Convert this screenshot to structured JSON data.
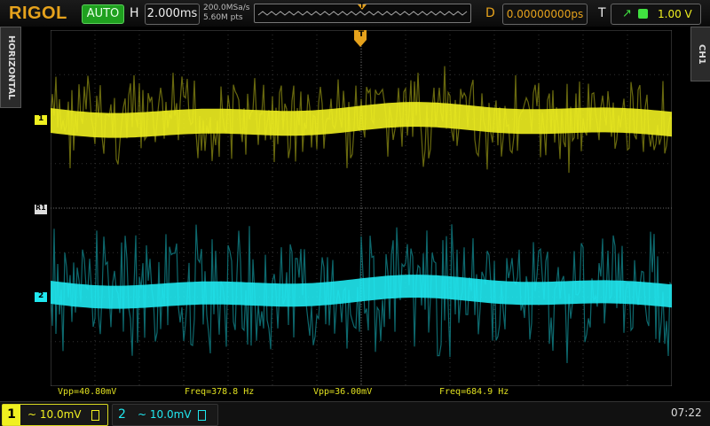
{
  "header": {
    "brand": "RIGOL",
    "run_mode": "AUTO",
    "timebase_letter": "H",
    "timebase": "2.000ms",
    "sample_rate": "200.0MSa/s",
    "memory_depth": "5.60M pts",
    "delay_letter": "D",
    "delay": "0.00000000ps",
    "trigger_letter": "T",
    "trigger_level": "1.00 V",
    "trigger_marker": "T"
  },
  "side": {
    "left_tab": "HORIZONTAL",
    "right_tab": "CH1"
  },
  "markers": {
    "ch1": "1",
    "ch2": "2",
    "ref": "R1"
  },
  "measurements": [
    {
      "text": "Vpp=40.80mV"
    },
    {
      "text": "Freq=378.8 Hz"
    },
    {
      "text": "Vpp=36.00mV"
    },
    {
      "text": "Freq=684.9 Hz"
    }
  ],
  "channels": [
    {
      "number": "1",
      "scale": "~ 10.0mV",
      "color": "#f0f020"
    },
    {
      "number": "2",
      "scale": "~ 10.0mV",
      "color": "#20e8f0"
    }
  ],
  "status": {
    "clock": "07:22"
  },
  "colors": {
    "accent": "#e6a21c",
    "ch1": "#f0f020",
    "ch2": "#20e8f0",
    "run_mode": "#1fa01f",
    "measurement_text": "#40d8ff"
  },
  "icons": {
    "trigger_edge": "rising-edge-icon",
    "trigger_source": "ch1-source-icon",
    "coupling": "dc-coupling-icon"
  }
}
